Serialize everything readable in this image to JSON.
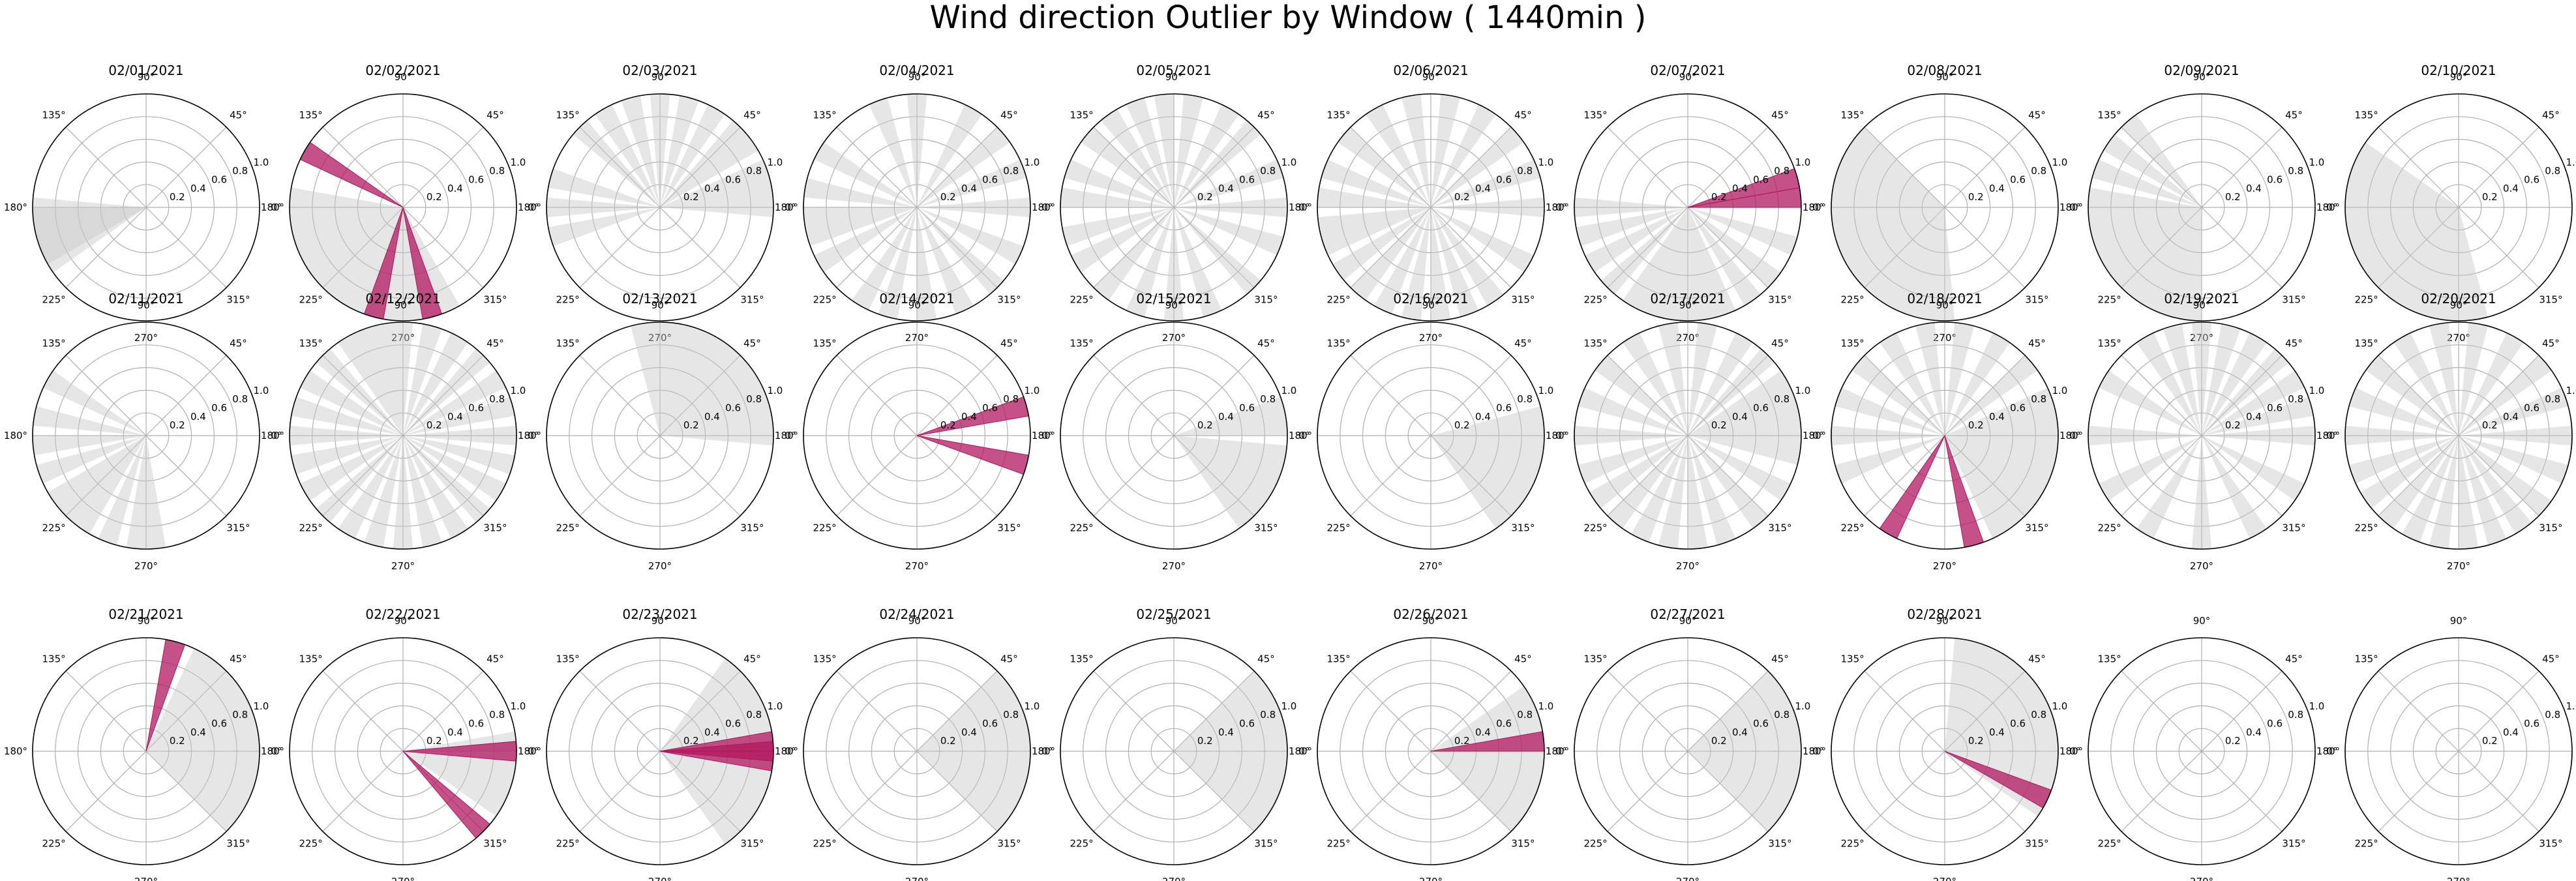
{
  "title": "Wind direction Outlier by Window ( 1440min )",
  "colors": {
    "normal": "#c8c8c8",
    "outlier": "#b0175f",
    "grid": "#b0b0b0",
    "frame": "#000000"
  },
  "angle_labels": [
    "0°",
    "45°",
    "90°",
    "135°",
    "180°",
    "225°",
    "270°",
    "315°"
  ],
  "radial_labels": [
    "0.2",
    "0.4",
    "0.6",
    "0.8",
    "1.0"
  ],
  "chart_data": {
    "type": "polar",
    "r_lim": [
      0,
      1.0
    ],
    "bar_width_deg": 10,
    "panels": [
      {
        "title": "02/01/2021",
        "normal": [
          180,
          185,
          190,
          195,
          200,
          205,
          210
        ],
        "outliers": []
      },
      {
        "title": "02/02/2021",
        "normal": [
          175,
          185,
          195,
          205,
          215,
          225,
          235,
          245,
          255,
          265,
          275,
          285,
          295
        ],
        "outliers": [
          150,
          255,
          285
        ]
      },
      {
        "title": "02/03/2021",
        "normal": [
          0,
          10,
          20,
          35,
          45,
          60,
          75,
          90,
          105,
          120,
          135,
          165,
          180,
          195
        ],
        "outliers": []
      },
      {
        "title": "02/04/2021",
        "normal": [
          0,
          20,
          40,
          60,
          90,
          110,
          150,
          170,
          185,
          195,
          210,
          240,
          255,
          275,
          295,
          315,
          335
        ],
        "outliers": []
      },
      {
        "title": "02/05/2021",
        "normal": [
          0,
          20,
          45,
          60,
          80,
          95,
          110,
          125,
          140,
          160,
          175,
          195,
          210,
          230,
          250,
          270,
          290,
          315,
          340
        ],
        "outliers": []
      },
      {
        "title": "02/06/2021",
        "normal": [
          0,
          20,
          40,
          60,
          80,
          100,
          120,
          140,
          160,
          175,
          190,
          200,
          215,
          230,
          245,
          260,
          275,
          290,
          305,
          330
        ],
        "outliers": []
      },
      {
        "title": "02/07/2021",
        "normal": [
          180,
          195,
          210,
          225,
          240,
          250,
          260,
          270,
          280,
          290,
          305,
          320,
          340
        ],
        "outliers": [
          15,
          5
        ]
      },
      {
        "title": "02/08/2021",
        "normal": [
          140,
          150,
          160,
          170,
          180,
          190,
          200,
          210,
          220,
          230,
          240,
          250,
          260,
          270
        ],
        "outliers": []
      },
      {
        "title": "02/09/2021",
        "normal": [
          130,
          145,
          160,
          175,
          185,
          195,
          205,
          215,
          225,
          235,
          245,
          255,
          265
        ],
        "outliers": []
      },
      {
        "title": "02/10/2021",
        "normal": [
          150,
          160,
          170,
          180,
          190,
          200,
          210,
          220,
          230,
          240,
          250,
          260,
          270,
          280
        ],
        "outliers": []
      },
      {
        "title": "02/11/2021",
        "normal": [
          150,
          170,
          185,
          200,
          215,
          225,
          235,
          250,
          265,
          275
        ],
        "outliers": []
      },
      {
        "title": "02/12/2021",
        "normal": [
          0,
          15,
          30,
          45,
          60,
          75,
          90,
          100,
          110,
          120,
          135,
          150,
          165,
          180,
          195,
          210,
          225,
          240,
          255,
          270,
          285,
          300,
          315,
          330,
          345
        ],
        "outliers": []
      },
      {
        "title": "02/13/2021",
        "normal": [
          0,
          10,
          20,
          30,
          40,
          50,
          60,
          70,
          80,
          90,
          100
        ],
        "outliers": []
      },
      {
        "title": "02/14/2021",
        "normal": [],
        "outliers": [
          15,
          345
        ]
      },
      {
        "title": "02/15/2021",
        "normal": [
          350,
          340,
          330,
          320,
          310,
          5,
          15
        ],
        "outliers": []
      },
      {
        "title": "02/16/2021",
        "normal": [
          0,
          350,
          340,
          330,
          320,
          310,
          10
        ],
        "outliers": []
      },
      {
        "title": "02/17/2021",
        "normal": [
          0,
          10,
          20,
          30,
          45,
          60,
          80,
          100,
          120,
          140,
          160,
          180,
          200,
          215,
          230,
          245,
          260,
          275,
          290,
          310,
          330,
          350
        ],
        "outliers": []
      },
      {
        "title": "02/18/2021",
        "normal": [
          0,
          10,
          20,
          40,
          60,
          80,
          100,
          120,
          140,
          160,
          180,
          200,
          300,
          310,
          320,
          330,
          340,
          350
        ],
        "outliers": [
          240,
          285
        ]
      },
      {
        "title": "02/19/2021",
        "normal": [
          0,
          15,
          30,
          45,
          60,
          75,
          90,
          105,
          120,
          150,
          180,
          210,
          240,
          270,
          300,
          330
        ],
        "outliers": []
      },
      {
        "title": "02/20/2021",
        "normal": [
          0,
          20,
          40,
          60,
          80,
          100,
          120,
          140,
          160,
          180,
          200,
          215,
          230,
          245,
          260,
          275,
          290,
          305,
          320,
          340
        ],
        "outliers": []
      },
      {
        "title": "02/21/2021",
        "normal": [
          0,
          350,
          340,
          330,
          320,
          10,
          20,
          30,
          40,
          50,
          60
        ],
        "outliers": [
          75
        ]
      },
      {
        "title": "02/22/2021",
        "normal": [
          0,
          350,
          340,
          330,
          5
        ],
        "outliers": [
          0,
          315
        ]
      },
      {
        "title": "02/23/2021",
        "normal": [
          0,
          10,
          20,
          30,
          40,
          50,
          350,
          340,
          330,
          320,
          310
        ],
        "outliers": [
          0,
          355,
          5
        ]
      },
      {
        "title": "02/24/2021",
        "normal": [
          0,
          10,
          20,
          30,
          40,
          350,
          340,
          330,
          320
        ],
        "outliers": []
      },
      {
        "title": "02/25/2021",
        "normal": [
          0,
          10,
          20,
          30,
          40,
          350,
          340,
          330,
          320
        ],
        "outliers": []
      },
      {
        "title": "02/26/2021",
        "normal": [
          0,
          10,
          20,
          30,
          350,
          340,
          330,
          320
        ],
        "outliers": [
          5
        ]
      },
      {
        "title": "02/27/2021",
        "normal": [
          0,
          10,
          20,
          30,
          40,
          350,
          340,
          330,
          320
        ],
        "outliers": []
      },
      {
        "title": "02/28/2021",
        "normal": [
          0,
          10,
          20,
          30,
          40,
          50,
          60,
          70,
          80,
          350,
          340,
          330
        ],
        "outliers": [
          335
        ]
      },
      {
        "title": "",
        "normal": [],
        "outliers": []
      },
      {
        "title": "",
        "normal": [],
        "outliers": []
      }
    ]
  }
}
